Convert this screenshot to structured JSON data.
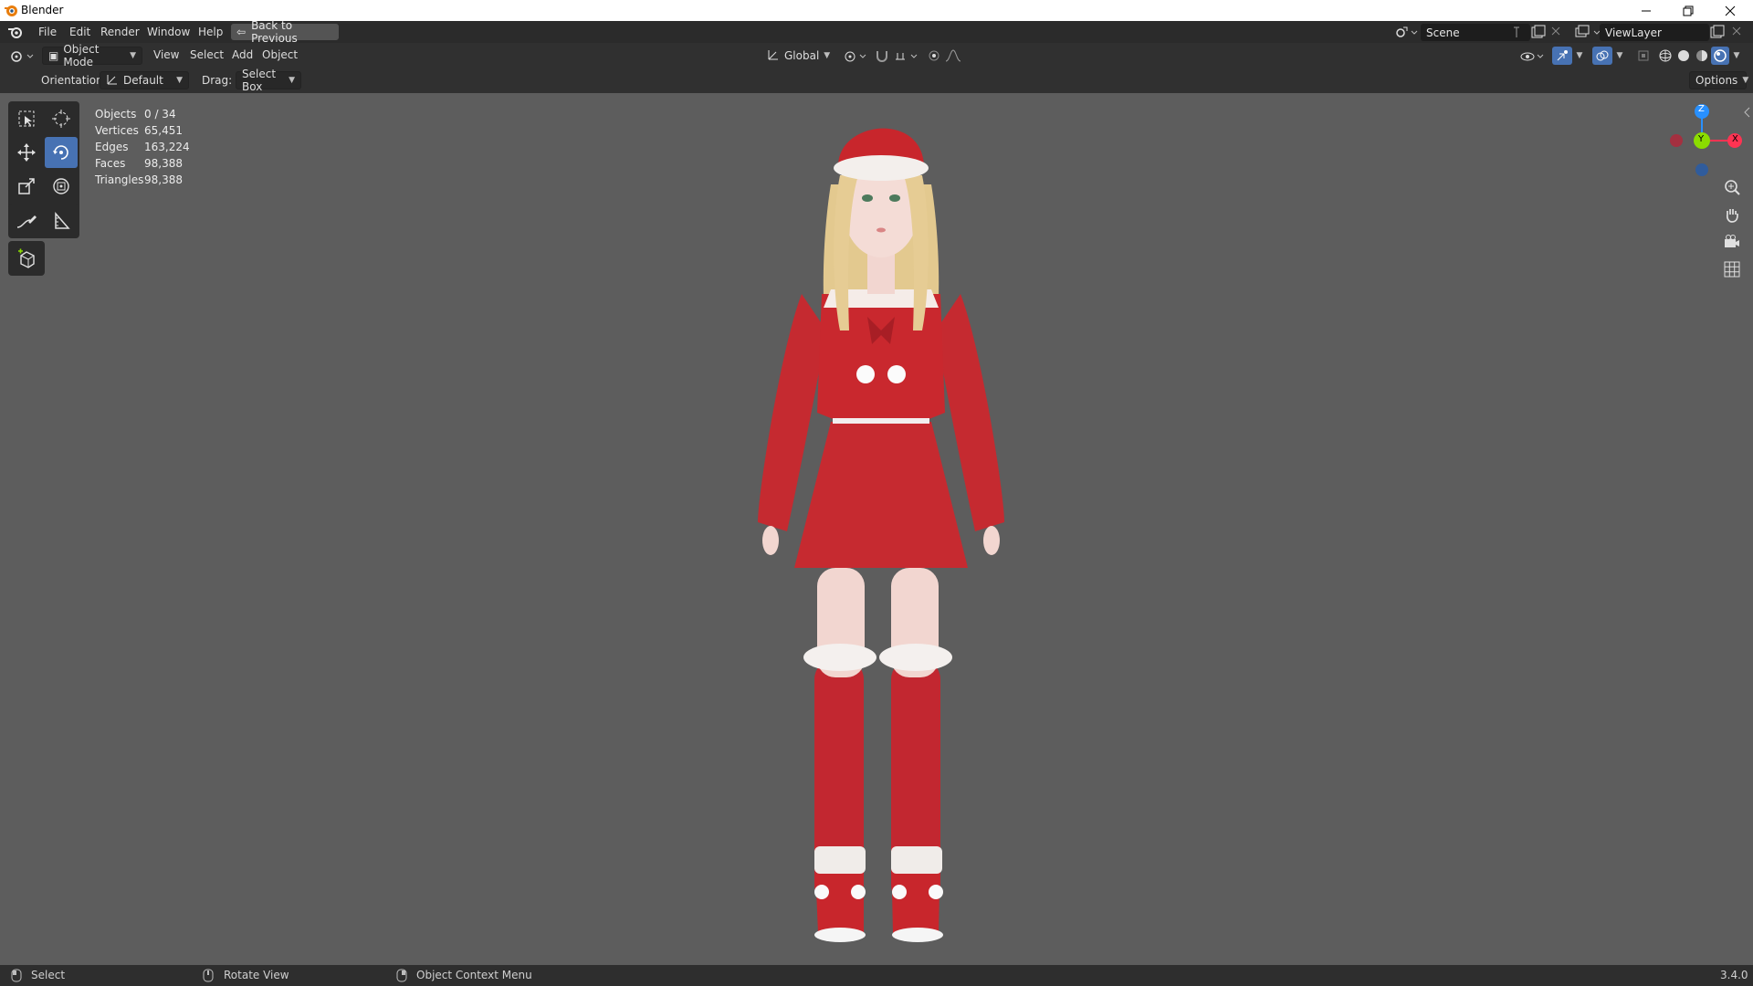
{
  "window": {
    "title": "Blender",
    "controls": [
      "minimize",
      "restore",
      "close"
    ]
  },
  "menubar": {
    "items": [
      "File",
      "Edit",
      "Render",
      "Window",
      "Help"
    ],
    "back_button": "Back to Previous",
    "scene": "Scene",
    "view_layer": "ViewLayer"
  },
  "viewport_header": {
    "mode": "Object Mode",
    "menus": [
      "View",
      "Select",
      "Add",
      "Object"
    ],
    "transform_orientation": "Global"
  },
  "tool_settings": {
    "orientation_label": "Orientation:",
    "orientation_value": "Default",
    "drag_label": "Drag:",
    "drag_value": "Select Box",
    "options": "Options"
  },
  "stats": [
    {
      "label": "Objects",
      "value": "0 / 34"
    },
    {
      "label": "Vertices",
      "value": "65,451"
    },
    {
      "label": "Edges",
      "value": "163,224"
    },
    {
      "label": "Faces",
      "value": "98,388"
    },
    {
      "label": "Triangles",
      "value": "98,388"
    }
  ],
  "gizmo": {
    "z": "Z",
    "y": "Y",
    "x": "X"
  },
  "statusbar": {
    "select": "Select",
    "rotate": "Rotate View",
    "context": "Object Context Menu",
    "version": "3.4.0"
  },
  "colors": {
    "accent": "#4772b3",
    "viewport_bg": "#5d5d5d",
    "axis_x": "#ff3352",
    "axis_y": "#8bdc00",
    "axis_z": "#2890ff",
    "outfit_red": "#c8262c"
  },
  "icons": [
    "blender-logo-icon",
    "editor-type-icon",
    "object-mode-icon",
    "orientation-icon",
    "pivot-icon",
    "snap-icon",
    "proportional-icon",
    "visibility-icon",
    "gizmo-icon",
    "overlay-icon",
    "xray-icon",
    "wireframe-shading-icon",
    "solid-shading-icon",
    "material-shading-icon",
    "rendered-shading-icon",
    "select-box-icon",
    "cursor-icon",
    "move-icon",
    "rotate-icon",
    "scale-icon",
    "transform-icon",
    "annotate-icon",
    "measure-icon",
    "add-cube-icon",
    "zoom-icon",
    "pan-hand-icon",
    "camera-icon",
    "grid-icon"
  ]
}
